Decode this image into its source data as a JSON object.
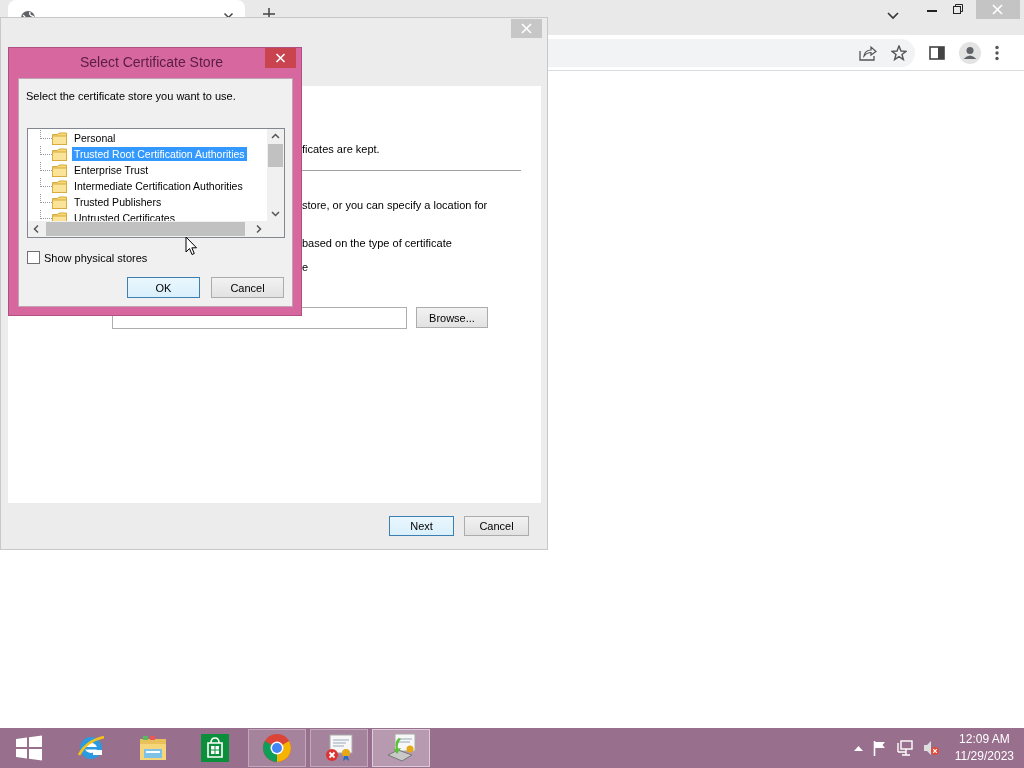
{
  "wizard": {
    "fragments": [
      {
        "text": "ficates are kept.",
        "divider_after": true
      },
      {
        "text": "store, or you can specify a location for",
        "divider_after": false
      },
      {
        "text": "based on the type of certificate",
        "divider_after": false
      },
      {
        "text": "e",
        "divider_after": false
      }
    ],
    "browse_button": "Browse...",
    "footer_buttons": [
      {
        "label": "Next",
        "default": true
      },
      {
        "label": "Cancel",
        "default": false
      }
    ]
  },
  "dialog": {
    "title": "Select Certificate Store",
    "prompt": "Select the certificate store you want to use.",
    "stores": [
      {
        "label": "Personal",
        "selected": false
      },
      {
        "label": "Trusted Root Certification Authorities",
        "selected": true
      },
      {
        "label": "Enterprise Trust",
        "selected": false
      },
      {
        "label": "Intermediate Certification Authorities",
        "selected": false
      },
      {
        "label": "Trusted Publishers",
        "selected": false
      },
      {
        "label": "Untrusted Certificates",
        "selected": false
      }
    ],
    "show_physical_stores": {
      "label": "Show physical stores",
      "checked": false
    },
    "buttons": [
      {
        "label": "OK",
        "default": true
      },
      {
        "label": "Cancel",
        "default": false
      }
    ]
  },
  "taskbar": {
    "items": [
      {
        "kind": "start",
        "running": false,
        "selected": false
      },
      {
        "kind": "ie",
        "running": false,
        "selected": false
      },
      {
        "kind": "files",
        "running": false,
        "selected": false
      },
      {
        "kind": "store",
        "running": false,
        "selected": false
      },
      {
        "kind": "chrome",
        "running": true,
        "selected": false
      },
      {
        "kind": "cert-error",
        "running": true,
        "selected": false
      },
      {
        "kind": "cert-import",
        "running": true,
        "selected": true
      }
    ],
    "clock": {
      "time": "12:09 AM",
      "date": "11/29/2023"
    }
  }
}
